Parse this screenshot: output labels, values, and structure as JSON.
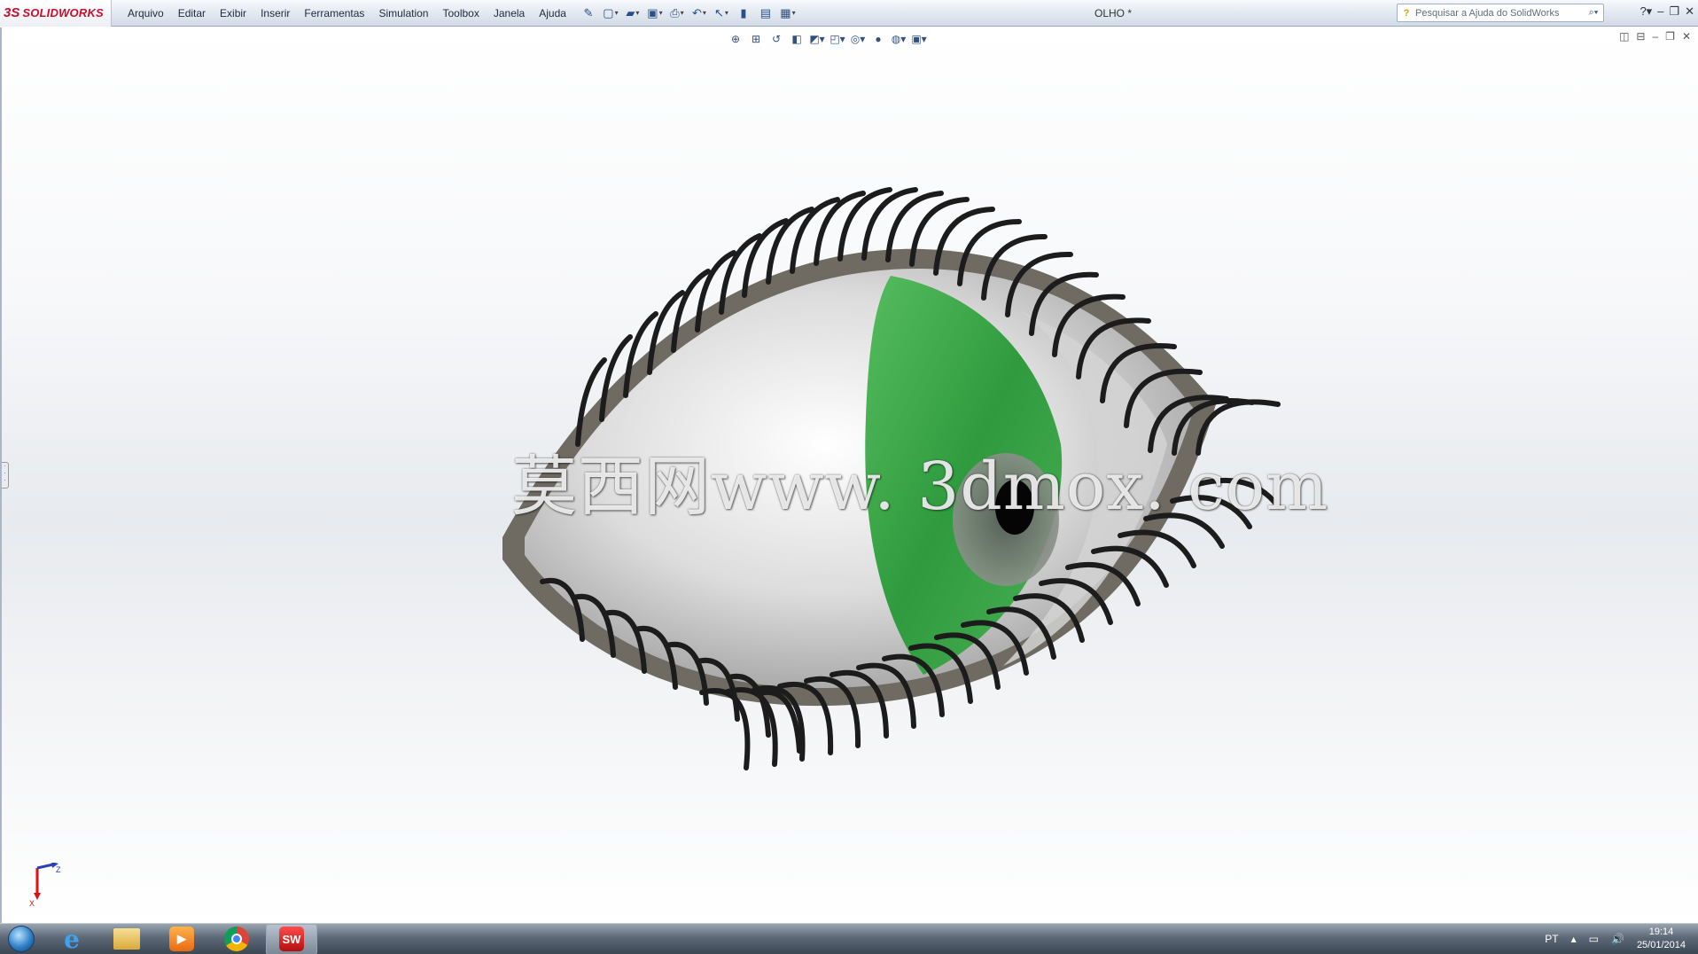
{
  "app": {
    "logo_ds": "3S",
    "logo_name": "SOLIDWORKS",
    "document_title": "OLHO *"
  },
  "menu": [
    "Arquivo",
    "Editar",
    "Exibir",
    "Inserir",
    "Ferramentas",
    "Simulation",
    "Toolbox",
    "Janela",
    "Ajuda"
  ],
  "search": {
    "placeholder": "Pesquisar a Ajuda do SolidWorks"
  },
  "watermark": "莫西网www. 3dmox. com",
  "triad": {
    "x_label": "X",
    "z_label": "Z"
  },
  "taskbar": {
    "apps": [
      "start-orb",
      "internet-explorer",
      "file-explorer",
      "media-player",
      "chrome",
      "solidworks"
    ],
    "solidworks_label": "SW",
    "language": "PT",
    "time": "19:14",
    "date": "25/01/2014"
  },
  "colors": {
    "iris": "#3aa34a",
    "lash": "#1c1c1c",
    "eyelid": "#6f6b63",
    "brand": "#c8102e"
  }
}
